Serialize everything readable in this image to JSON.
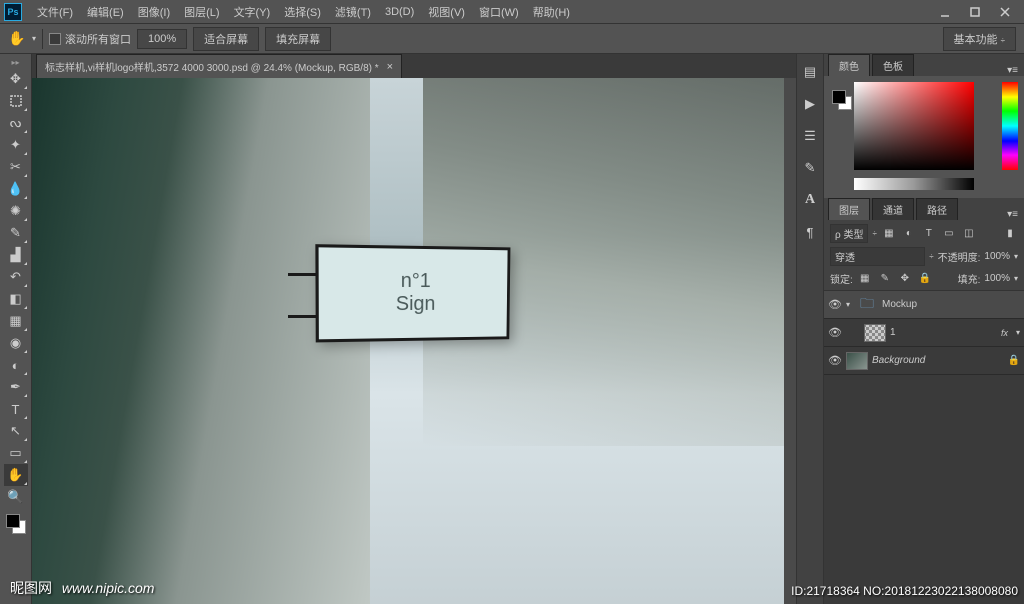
{
  "app": {
    "logo": "Ps"
  },
  "menu": {
    "file": "文件(F)",
    "edit": "编辑(E)",
    "image": "图像(I)",
    "layer": "图层(L)",
    "type": "文字(Y)",
    "select": "选择(S)",
    "filter": "滤镜(T)",
    "threed": "3D(D)",
    "view": "视图(V)",
    "window": "窗口(W)",
    "help": "帮助(H)"
  },
  "options": {
    "scroll_all": "滚动所有窗口",
    "zoom_level": "100%",
    "fit_screen": "适合屏幕",
    "fill_screen": "填充屏幕",
    "workspace": "基本功能"
  },
  "document": {
    "tab_title": "标志样机,vi样机logo样机,3572 4000 3000.psd @ 24.4% (Mockup, RGB/8) *"
  },
  "sign": {
    "line1": "n°1",
    "line2": "Sign"
  },
  "panels": {
    "color_tab": "颜色",
    "swatches_tab": "色板",
    "layers_tab": "图层",
    "channels_tab": "通道",
    "paths_tab": "路径"
  },
  "layers": {
    "kind_label": "ρ 类型",
    "blend_mode": "穿透",
    "opacity_label": "不透明度:",
    "opacity_value": "100%",
    "lock_label": "锁定:",
    "fill_label": "填充:",
    "fill_value": "100%",
    "items": [
      {
        "name": "Mockup",
        "type": "group"
      },
      {
        "name": "1",
        "type": "layer",
        "fx": "fx"
      },
      {
        "name": "Background",
        "type": "bg"
      }
    ]
  },
  "watermark": {
    "brand": "昵图网",
    "site": "www.nipic.com"
  },
  "footer": {
    "id": "ID:21718364 NO:20181223022138008080"
  }
}
